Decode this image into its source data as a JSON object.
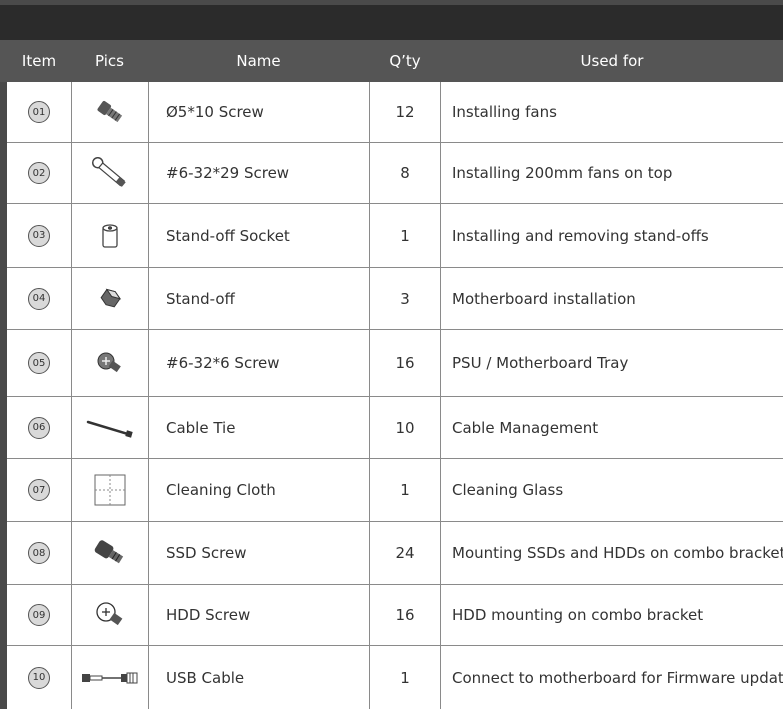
{
  "headers": {
    "item": "Item",
    "pics": "Pics",
    "name": "Name",
    "qty": "Q’ty",
    "used": "Used for"
  },
  "rows": [
    {
      "item": "01",
      "icon": "screw-icon",
      "name": "Ø5*10 Screw",
      "qty": "12",
      "used": "Installing fans"
    },
    {
      "item": "02",
      "icon": "long-screw-icon",
      "name": "#6-32*29 Screw",
      "qty": "8",
      "used": "Installing 200mm fans on top"
    },
    {
      "item": "03",
      "icon": "socket-icon",
      "name": "Stand-off Socket",
      "qty": "1",
      "used": "Installing and removing stand-offs"
    },
    {
      "item": "04",
      "icon": "standoff-icon",
      "name": "Stand-off",
      "qty": "3",
      "used": "Motherboard installation"
    },
    {
      "item": "05",
      "icon": "screw-icon",
      "name": "#6-32*6 Screw",
      "qty": "16",
      "used": "PSU / Motherboard Tray"
    },
    {
      "item": "06",
      "icon": "cable-tie-icon",
      "name": "Cable Tie",
      "qty": "10",
      "used": "Cable Management"
    },
    {
      "item": "07",
      "icon": "cloth-icon",
      "name": "Cleaning Cloth",
      "qty": "1",
      "used": "Cleaning Glass"
    },
    {
      "item": "08",
      "icon": "ssd-screw-icon",
      "name": "SSD Screw",
      "qty": "24",
      "used": "Mounting SSDs and HDDs on combo bracket"
    },
    {
      "item": "09",
      "icon": "hdd-screw-icon",
      "name": "HDD Screw",
      "qty": "16",
      "used": "HDD mounting on combo bracket"
    },
    {
      "item": "10",
      "icon": "usb-cable-icon",
      "name": "USB Cable",
      "qty": "1",
      "used": "Connect to motherboard for Firmware update"
    }
  ]
}
